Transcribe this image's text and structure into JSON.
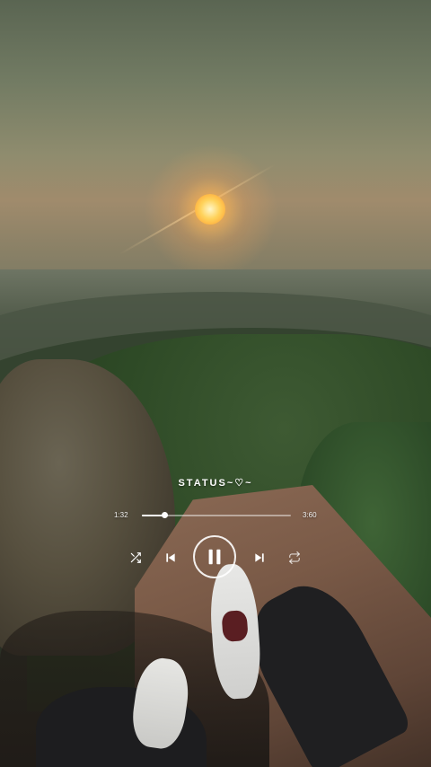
{
  "player": {
    "title": "STATUS~♡~",
    "current_time": "1:32",
    "total_time": "3:60",
    "progress_fraction": 0.15,
    "state": "playing"
  },
  "controls": {
    "shuffle_icon": "shuffle-icon",
    "prev_icon": "skip-previous-icon",
    "play_pause_icon": "pause-icon",
    "next_icon": "skip-next-icon",
    "repeat_icon": "repeat-icon"
  },
  "colors": {
    "accent": "#ffffff",
    "sun": "#ffd25a"
  }
}
